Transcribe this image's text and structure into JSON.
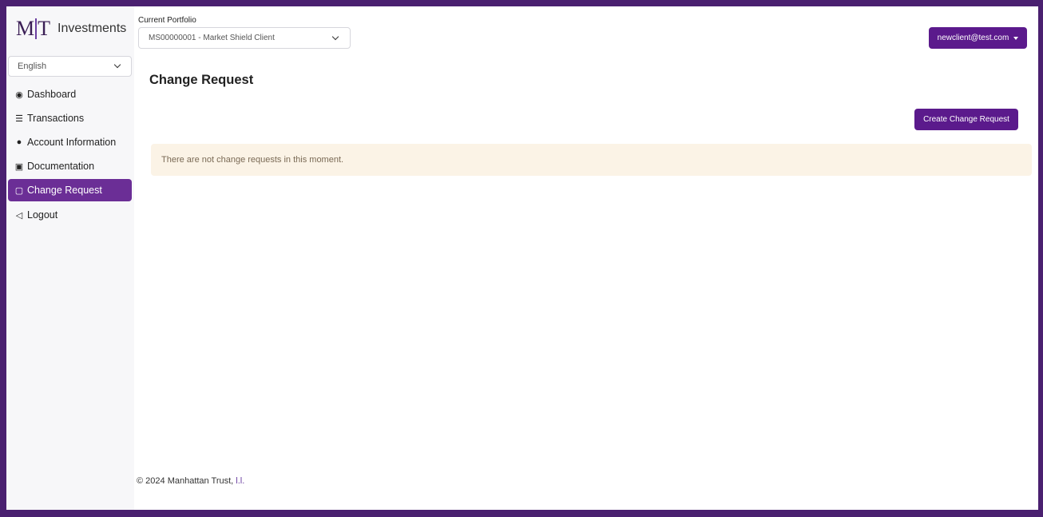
{
  "brand": {
    "logo_m": "M",
    "logo_t": "T",
    "name": "Investments"
  },
  "language": {
    "selected": "English"
  },
  "sidebar": {
    "items": [
      {
        "label": "Dashboard",
        "icon": "dashboard-icon",
        "active": false
      },
      {
        "label": "Transactions",
        "icon": "list-icon",
        "active": false
      },
      {
        "label": "Account Information",
        "icon": "user-circle-icon",
        "active": false
      },
      {
        "label": "Documentation",
        "icon": "document-person-icon",
        "active": false
      },
      {
        "label": "Change Request",
        "icon": "file-edit-icon",
        "active": true
      },
      {
        "label": "Logout",
        "icon": "logout-icon",
        "active": false
      }
    ]
  },
  "header": {
    "portfolio_label": "Current Portfolio",
    "portfolio_selected": "MS00000001 - Market Shield Client",
    "user_email": "newclient@test.com"
  },
  "main": {
    "title": "Change Request",
    "create_button": "Create Change Request",
    "empty_message": "There are not change requests in this moment."
  },
  "footer": {
    "text": "© 2024 Manhattan Trust,",
    "tail": "l.l."
  },
  "colors": {
    "accent": "#5b1a8c",
    "active_nav": "#6b2e96",
    "frame": "#4a2070",
    "alert_bg": "#fbf3e6"
  }
}
